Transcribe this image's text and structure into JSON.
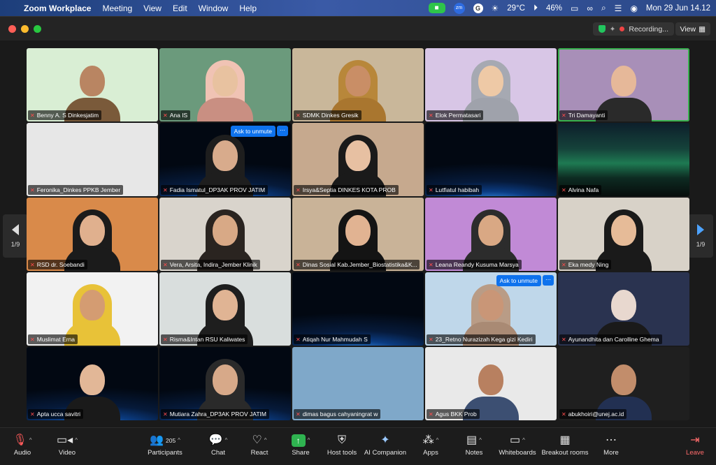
{
  "menubar": {
    "app": "Zoom Workplace",
    "menus": [
      "Meeting",
      "View",
      "Edit",
      "Window",
      "Help"
    ],
    "temperature": "29°C",
    "battery": "46%",
    "datetime": "Mon 29 Jun  14.12"
  },
  "titlebar": {
    "recording": "Recording...",
    "view": "View"
  },
  "pager": {
    "page": "1/9"
  },
  "participants": [
    {
      "name": "Benny A. S Dinkesjatim",
      "bg": "#d9eed4",
      "skin": "#b98562",
      "hijab": "",
      "body": "#7a5a3a"
    },
    {
      "name": "Ana IS",
      "bg": "#6b9a7c",
      "skin": "#e8c2a0",
      "hijab": "#f0c3b4",
      "body": "#c98f82"
    },
    {
      "name": "SDMK Dinkes Gresik",
      "bg": "#c9b79a",
      "skin": "#c98e66",
      "hijab": "#b8873a",
      "body": "#a9762f"
    },
    {
      "name": "Elok Permatasari",
      "bg": "#d8c6e6",
      "skin": "#eec9a6",
      "hijab": "#a6a9b2",
      "body": "#9fa2ab"
    },
    {
      "name": "Tri Damayanti",
      "bg": "#a88fb8",
      "skin": "#e6b899",
      "hijab": "",
      "body": "#2a2a2a",
      "active": true
    },
    {
      "name": "Feronika_Dinkes PPKB Jember",
      "bg": "#e7e7e7",
      "skin": "",
      "hijab": "",
      "body": ""
    },
    {
      "name": "Fadia Ismatul_DP3AK PROV JATIM",
      "bg": "space",
      "skin": "#d8ab8c",
      "hijab": "#1e1e1e",
      "body": "#1e1e1e",
      "unmute": "Ask to unmute"
    },
    {
      "name": "Irsya&Septia DINKES KOTA PROB",
      "bg": "#c6a98e",
      "skin": "#e7c0a2",
      "hijab": "#1a1a1a",
      "body": "#1a1a1a"
    },
    {
      "name": "Lutfiatul habibah",
      "bg": "space",
      "skin": "",
      "hijab": "",
      "body": ""
    },
    {
      "name": "Alvina Nafa",
      "bg": "aurora",
      "skin": "",
      "hijab": "",
      "body": ""
    },
    {
      "name": "RSD dr. Soebandi",
      "bg": "#d98a4a",
      "skin": "#e0b08e",
      "hijab": "#1b1b1b",
      "body": "#1b1b1b"
    },
    {
      "name": "Vera, Arsita, Indira_Jember Klinik",
      "bg": "#d9d4cc",
      "skin": "#d8a986",
      "hijab": "#2a2420",
      "body": "#2a2420"
    },
    {
      "name": "Dinas Sosial Kab.Jember_Biostatistika&K...",
      "bg": "#c9b398",
      "skin": "#e1b392",
      "hijab": "#141414",
      "body": "#141414"
    },
    {
      "name": "Leana Reandy Kusuma Marsya",
      "bg": "#c18ad6",
      "skin": "#d9a884",
      "hijab": "#2c2c2c",
      "body": "#2c2c2c"
    },
    {
      "name": "Eka medy Ning",
      "bg": "#d8d2c8",
      "skin": "#e6bb98",
      "hijab": "#1a1a1a",
      "body": "#1a1a1a"
    },
    {
      "name": "Muslimat Erna",
      "bg": "#f2f2f2",
      "skin": "#d49c72",
      "hijab": "#e8c238",
      "body": "#e8c238"
    },
    {
      "name": "Risma&Intan RSU Kaliwates",
      "bg": "#d9dedd",
      "skin": "#e0b494",
      "hijab": "#1e1e1e",
      "body": "#1e1e1e"
    },
    {
      "name": "Atiqah Nur Mahmudah S",
      "bg": "space",
      "skin": "",
      "hijab": "",
      "body": ""
    },
    {
      "name": "23_Retno Nurazizah Kega gizi Kediri",
      "bg": "#bfd7ea",
      "skin": "#c99677",
      "hijab": "#b99c86",
      "body": "#a98a74",
      "unmute": "Ask to unmute"
    },
    {
      "name": "Ayunandhita dan Carolline Ghema",
      "bg": "#2a3350",
      "skin": "#e8d8cf",
      "hijab": "",
      "body": "#1a1a1a"
    },
    {
      "name": "Apta ucca savitri",
      "bg": "space",
      "skin": "#e2b797",
      "hijab": "",
      "body": "#1a1a1a"
    },
    {
      "name": "Mutiara Zahra_DP3AK PROV JATIM",
      "bg": "space",
      "skin": "#d7a989",
      "hijab": "#2a2a2a",
      "body": "#2a2a2a"
    },
    {
      "name": "dimas bagus cahyaningrat w",
      "bg": "#7fa8c9",
      "skin": "",
      "hijab": "",
      "body": ""
    },
    {
      "name": "Agus BKK Prob",
      "bg": "#e9e9e9",
      "skin": "#b88060",
      "hijab": "",
      "body": "#3c4f72"
    },
    {
      "name": "abukhoiri@unej.ac.id",
      "bg": "#1f1f1f",
      "skin": "#c28d6b",
      "hijab": "",
      "body": "#223052"
    }
  ],
  "toolbar": {
    "audio": "Audio",
    "video": "Video",
    "participants": "Participants",
    "participants_count": "205",
    "chat": "Chat",
    "react": "React",
    "share": "Share",
    "host_tools": "Host tools",
    "ai_companion": "AI Companion",
    "apps": "Apps",
    "notes": "Notes",
    "whiteboards": "Whiteboards",
    "breakout_rooms": "Breakout rooms",
    "more": "More",
    "leave": "Leave"
  }
}
